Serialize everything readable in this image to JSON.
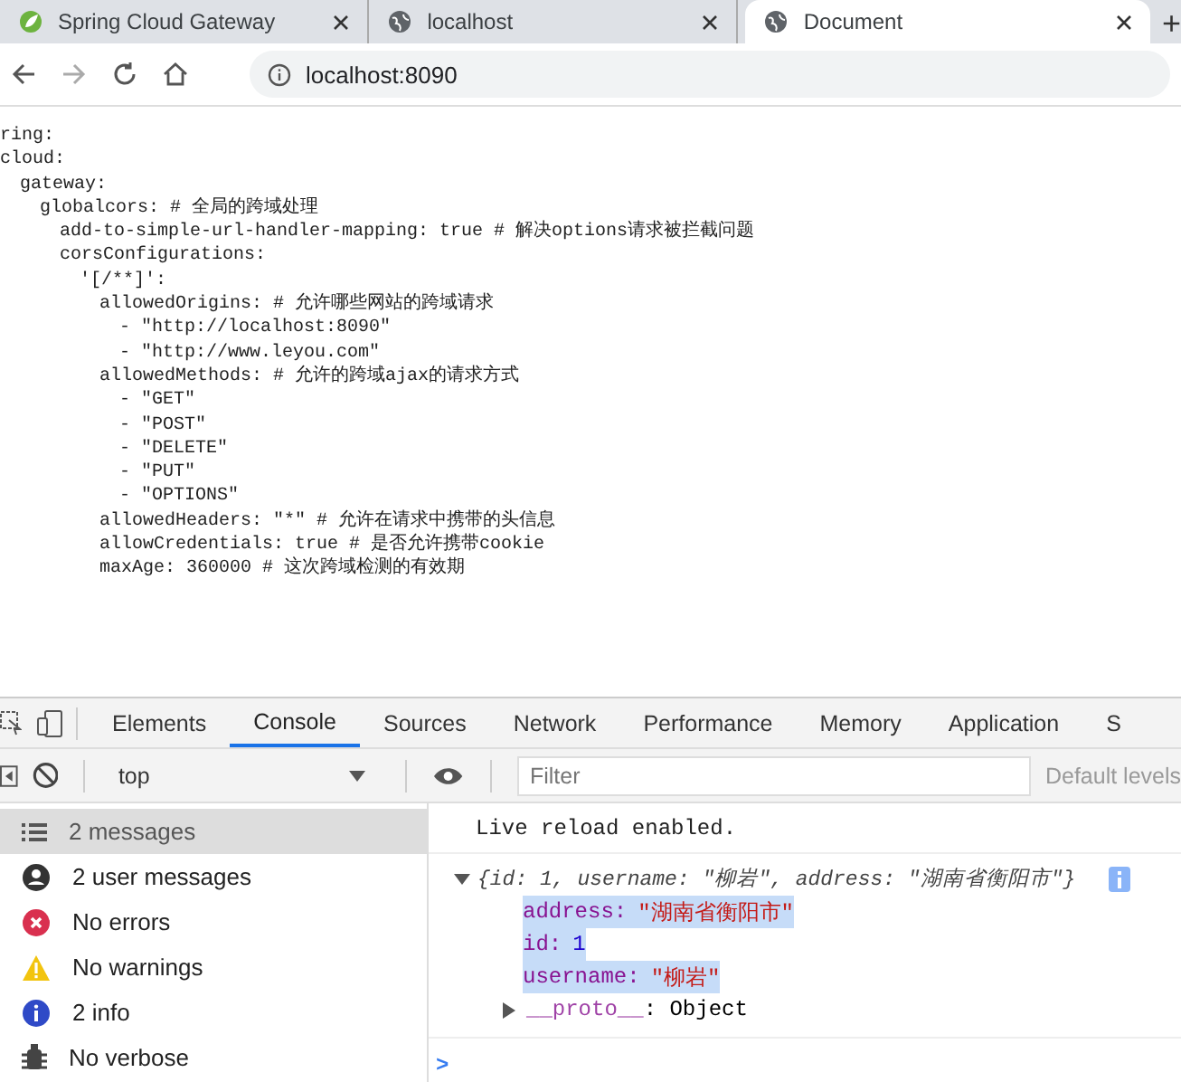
{
  "browser": {
    "tabs": [
      {
        "title": "Spring Cloud Gateway",
        "kind": "leaf",
        "selected": false
      },
      {
        "title": "localhost",
        "kind": "globe",
        "selected": false
      },
      {
        "title": "Document",
        "kind": "globe",
        "selected": true
      }
    ],
    "new_tab": "+",
    "address": "localhost:8090"
  },
  "code": [
    {
      "text": "ring:",
      "children": [
        {
          "text": "cloud:",
          "children": [
            {
              "text": "gateway:",
              "children": [
                {
                  "text": "globalcors: # 全局的跨域处理",
                  "children": [
                    {
                      "text": "add-to-simple-url-handler-mapping: true # 解决options请求被拦截问题"
                    },
                    {
                      "text": "corsConfigurations:",
                      "children": [
                        {
                          "text": "'[/**]':",
                          "children": [
                            {
                              "text": "allowedOrigins: # 允许哪些网站的跨域请求",
                              "children": [
                                {
                                  "text": "- \"http://localhost:8090\""
                                },
                                {
                                  "text": "- \"http://www.leyou.com\""
                                }
                              ]
                            },
                            {
                              "text": "allowedMethods: # 允许的跨域ajax的请求方式",
                              "children": [
                                {
                                  "text": "- \"GET\""
                                },
                                {
                                  "text": "- \"POST\""
                                },
                                {
                                  "text": "- \"DELETE\""
                                },
                                {
                                  "text": "- \"PUT\""
                                },
                                {
                                  "text": "- \"OPTIONS\""
                                }
                              ]
                            },
                            {
                              "text": "allowedHeaders: \"*\" # 允许在请求中携带的头信息"
                            },
                            {
                              "text": "allowCredentials: true # 是否允许携带cookie"
                            },
                            {
                              "text": "maxAge: 360000 # 这次跨域检测的有效期"
                            }
                          ]
                        }
                      ]
                    }
                  ]
                }
              ]
            }
          ]
        }
      ]
    }
  ],
  "devtools": {
    "tabs": [
      {
        "label": "Elements",
        "selected": false
      },
      {
        "label": "Console",
        "selected": true
      },
      {
        "label": "Sources",
        "selected": false
      },
      {
        "label": "Network",
        "selected": false
      },
      {
        "label": "Performance",
        "selected": false
      },
      {
        "label": "Memory",
        "selected": false
      },
      {
        "label": "Application",
        "selected": false
      },
      {
        "label": "S",
        "selected": false
      }
    ],
    "context": "top",
    "filter_placeholder": "Filter",
    "levels": "Default levels",
    "sidebar": [
      {
        "label": "2 messages",
        "kind": "list",
        "selected": true
      },
      {
        "label": "2 user messages",
        "kind": "user",
        "selected": false
      },
      {
        "label": "No errors",
        "kind": "error",
        "selected": false
      },
      {
        "label": "No warnings",
        "kind": "warning",
        "selected": false
      },
      {
        "label": "2 info",
        "kind": "info",
        "selected": false
      },
      {
        "label": "No verbose",
        "kind": "verbose",
        "selected": false
      }
    ],
    "console": {
      "log": "Live reload enabled.",
      "object": {
        "summary": "{id: 1, username: \"柳岩\", address: \"湖南省衡阳市\"}",
        "expanded": true,
        "properties": [
          {
            "key": "address:",
            "value": "\"湖南省衡阳市\"",
            "kind": "string",
            "highlighted": true
          },
          {
            "key": "id:",
            "value": "1",
            "kind": "number",
            "highlighted": true
          },
          {
            "key": "username:",
            "value": "\"柳岩\"",
            "kind": "string",
            "highlighted": true
          }
        ],
        "proto": {
          "key": "__proto__",
          "value": ": Object",
          "expanded": false
        }
      },
      "prompt": ">"
    }
  }
}
